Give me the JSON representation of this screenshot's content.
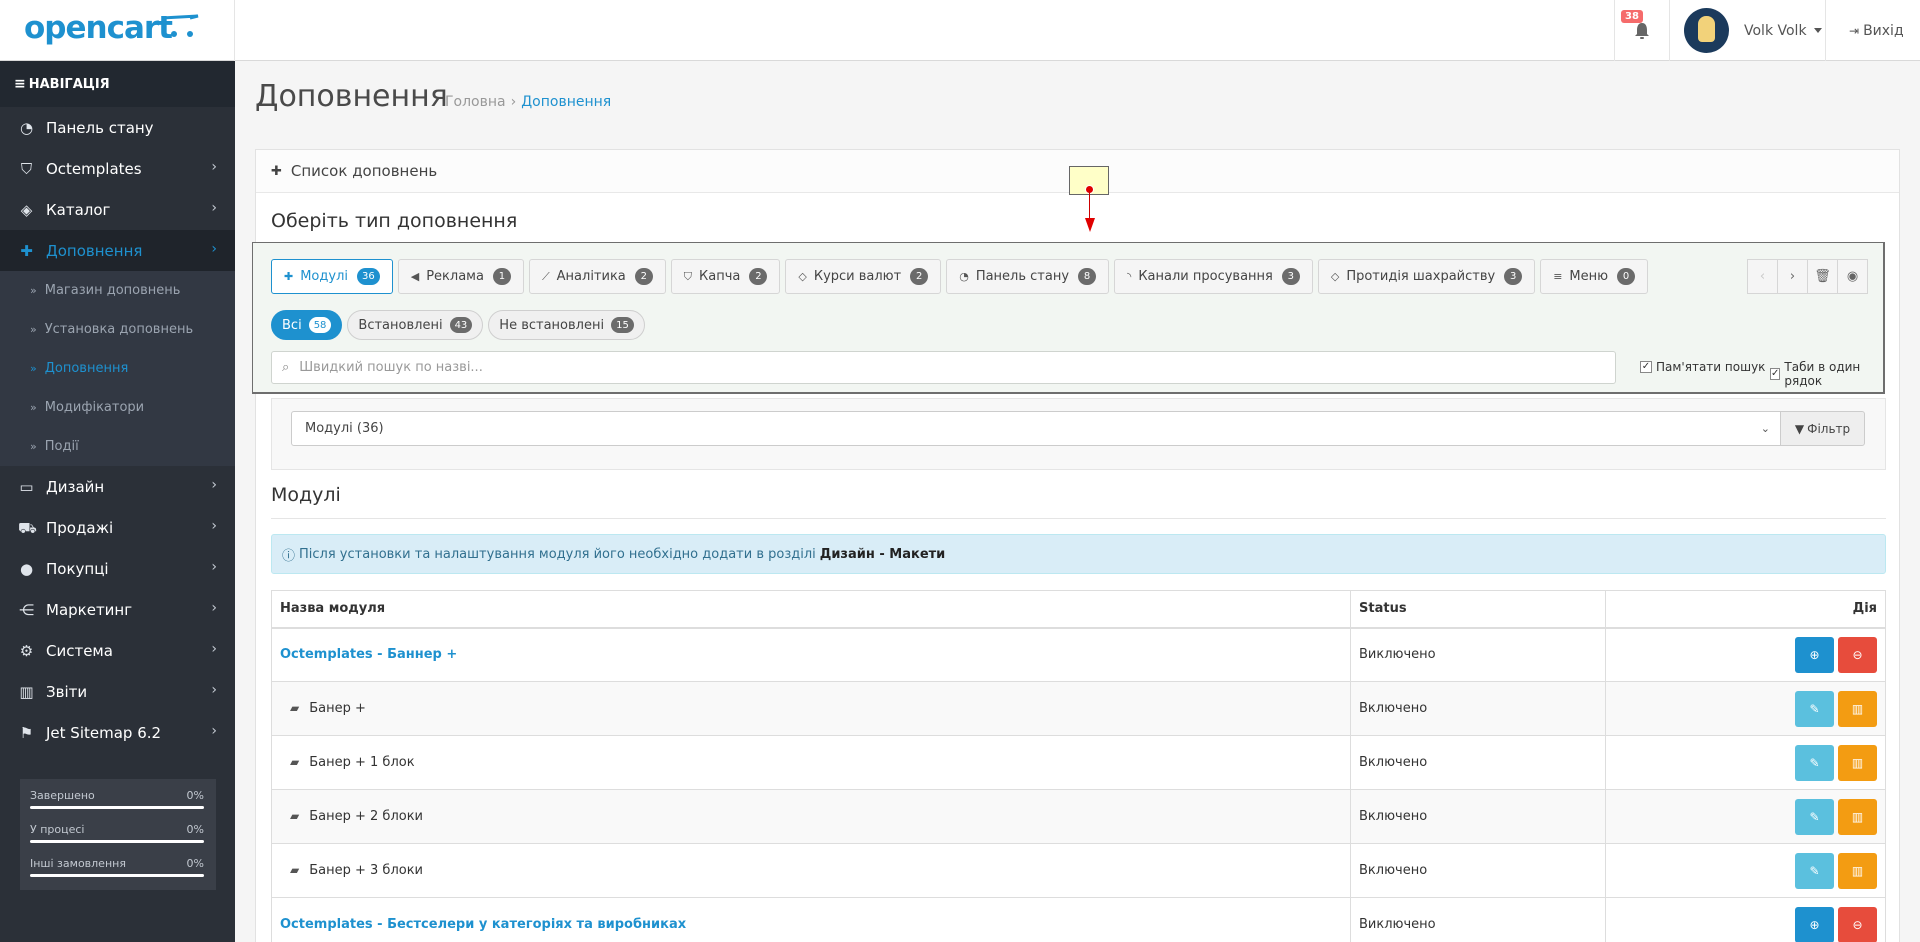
{
  "header": {
    "logo": "opencart",
    "notifications_count": "38",
    "user_name": "Volk Volk",
    "logout_label": "Вихід"
  },
  "sidebar": {
    "nav_title": "НАВІГАЦІЯ",
    "items": [
      {
        "label": "Панель стану",
        "icon": "dashboard-icon"
      },
      {
        "label": "Octemplates",
        "icon": "shield-icon"
      },
      {
        "label": "Каталог",
        "icon": "tags-icon"
      },
      {
        "label": "Доповнення",
        "icon": "puzzle-icon"
      },
      {
        "label": "Дизайн",
        "icon": "monitor-icon"
      },
      {
        "label": "Продажі",
        "icon": "cart-icon"
      },
      {
        "label": "Покупці",
        "icon": "user-icon"
      },
      {
        "label": "Маркетинг",
        "icon": "share-icon"
      },
      {
        "label": "Система",
        "icon": "gear-icon"
      },
      {
        "label": "Звіти",
        "icon": "chart-icon"
      },
      {
        "label": "Jet Sitemap 6.2",
        "icon": "sitemap-icon"
      }
    ],
    "submenu": [
      {
        "label": "Магазин доповнень"
      },
      {
        "label": "Установка доповнень"
      },
      {
        "label": "Доповнення"
      },
      {
        "label": "Модифікатори"
      },
      {
        "label": "Події"
      }
    ],
    "stats": [
      {
        "label": "Завершено",
        "value": "0%"
      },
      {
        "label": "У процесі",
        "value": "0%"
      },
      {
        "label": "Інші замовлення",
        "value": "0%"
      }
    ]
  },
  "page": {
    "title": "Доповнення",
    "breadcrumb_home": "Головна",
    "breadcrumb_sep": "›",
    "breadcrumb_current": "Доповнення",
    "panel_title": "Список доповнень",
    "type_title": "Оберіть тип доповнення"
  },
  "tabs": [
    {
      "label": "Модулі",
      "count": "36",
      "icon": "puzzle-icon"
    },
    {
      "label": "Реклама",
      "count": "1",
      "icon": "bullhorn-icon"
    },
    {
      "label": "Аналітика",
      "count": "2",
      "icon": "line-chart-icon"
    },
    {
      "label": "Капча",
      "count": "2",
      "icon": "shield-icon"
    },
    {
      "label": "Курси валют",
      "count": "2",
      "icon": "cube-icon"
    },
    {
      "label": "Панель стану",
      "count": "8",
      "icon": "dashboard-icon"
    },
    {
      "label": "Канали просування",
      "count": "3",
      "icon": "rss-icon"
    },
    {
      "label": "Протидія шахрайству",
      "count": "3",
      "icon": "cube-icon"
    },
    {
      "label": "Меню",
      "count": "0",
      "icon": "bars-icon"
    }
  ],
  "pills": [
    {
      "label": "Всі",
      "count": "58"
    },
    {
      "label": "Встановлені",
      "count": "43"
    },
    {
      "label": "Не встановлені",
      "count": "15"
    }
  ],
  "search": {
    "placeholder": "Швидкий пошук по назві...",
    "remember_label": "Пам'ятати пошук",
    "tabs_one_row_label": "Таби в один рядок"
  },
  "filter": {
    "selected": "Модулі (36)",
    "button_label": "Фільтр"
  },
  "section": {
    "title": "Модулі",
    "alert_text": "Після установки та налаштування модуля його необхідно додати в розділі",
    "alert_bold": "Дизайн - Макети"
  },
  "table": {
    "headers": [
      "Назва модуля",
      "Status",
      "Дія"
    ],
    "rows": [
      {
        "name": "Octemplates - Баннер +",
        "status": "Виключено",
        "type": "module"
      },
      {
        "name": "Банер +",
        "status": "Включено",
        "type": "child"
      },
      {
        "name": "Банер + 1 блок",
        "status": "Включено",
        "type": "child"
      },
      {
        "name": "Банер + 2 блоки",
        "status": "Включено",
        "type": "child"
      },
      {
        "name": "Банер + 3 блоки",
        "status": "Включено",
        "type": "child"
      },
      {
        "name": "Octemplates - Бестселери у категоріях та виробниках",
        "status": "Виключено",
        "type": "module"
      }
    ]
  },
  "colors": {
    "accent": "#1e91cf",
    "sidebar_bg": "#2b3038",
    "danger": "#e74c3c",
    "warning": "#f39c12",
    "info": "#5bc0de"
  }
}
